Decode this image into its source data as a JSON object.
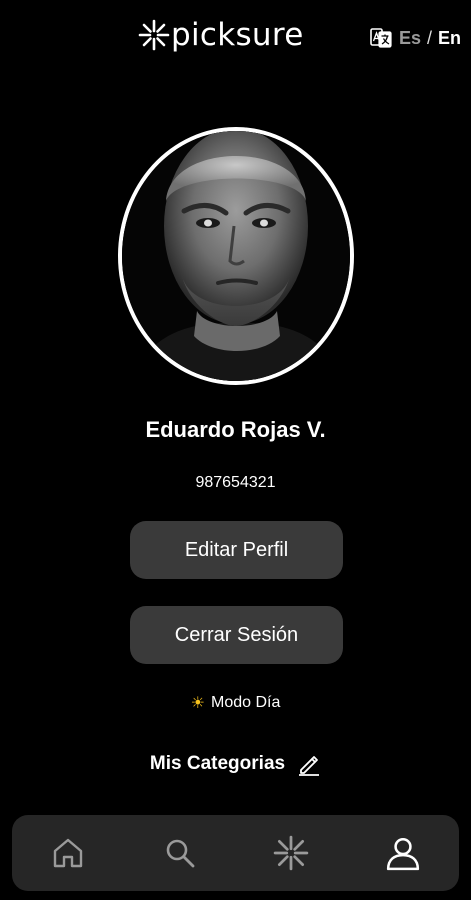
{
  "header": {
    "brand": "picksure",
    "language": {
      "es": "Es",
      "separator": "/",
      "en": "En",
      "active": "En"
    }
  },
  "profile": {
    "name": "Eduardo Rojas V.",
    "phone": "987654321",
    "avatar_alt": "profile-photo"
  },
  "actions": {
    "edit_label": "Editar Perfil",
    "logout_label": "Cerrar Sesión"
  },
  "day_mode": {
    "icon": "sun-icon",
    "label": "Modo Día"
  },
  "categories": {
    "title": "Mis Categorias",
    "edit_icon": "pencil-icon"
  },
  "bottom_nav": {
    "items": [
      {
        "id": "home",
        "icon": "home-icon"
      },
      {
        "id": "search",
        "icon": "search-icon"
      },
      {
        "id": "picksure",
        "icon": "picksure-star-icon"
      },
      {
        "id": "profile",
        "icon": "user-icon",
        "active": true
      }
    ]
  },
  "colors": {
    "background": "#000000",
    "button": "#3a3a3a",
    "nav_bar": "#262626",
    "text": "#ffffff",
    "inactive_icon": "#9a9a9a",
    "inactive_language": "#9a9a9a",
    "sun": "#f7c21d"
  }
}
